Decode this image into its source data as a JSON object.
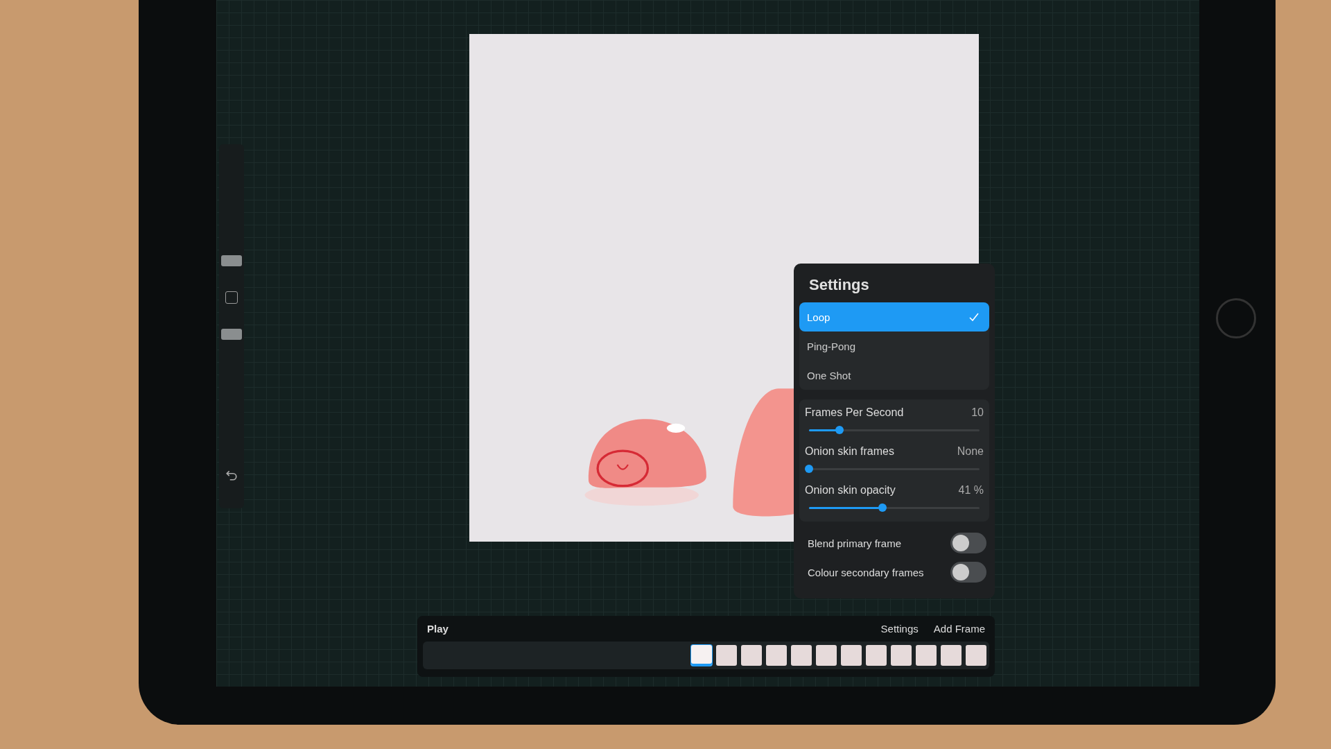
{
  "settings_popover": {
    "title": "Settings",
    "modes": [
      {
        "label": "Loop",
        "selected": true
      },
      {
        "label": "Ping-Pong",
        "selected": false
      },
      {
        "label": "One Shot",
        "selected": false
      }
    ],
    "sliders": [
      {
        "label": "Frames Per Second",
        "reading": "10",
        "level": 0.17
      },
      {
        "label": "Onion skin frames",
        "reading": "None",
        "level": 0
      },
      {
        "label": "Onion skin opacity",
        "reading": "41 %",
        "level": 0.41
      }
    ],
    "toggles": [
      {
        "label": "Blend primary frame",
        "on": false
      },
      {
        "label": "Colour secondary frames",
        "on": false
      }
    ]
  },
  "timeline": {
    "play": "Play",
    "settings": "Settings",
    "add_frame": "Add Frame",
    "frames": [
      {
        "selected": true
      },
      {
        "selected": false
      },
      {
        "selected": false
      },
      {
        "selected": false
      },
      {
        "selected": false
      },
      {
        "selected": false
      },
      {
        "selected": false
      },
      {
        "selected": false
      },
      {
        "selected": false
      },
      {
        "selected": false
      },
      {
        "selected": false
      },
      {
        "selected": false
      }
    ]
  }
}
